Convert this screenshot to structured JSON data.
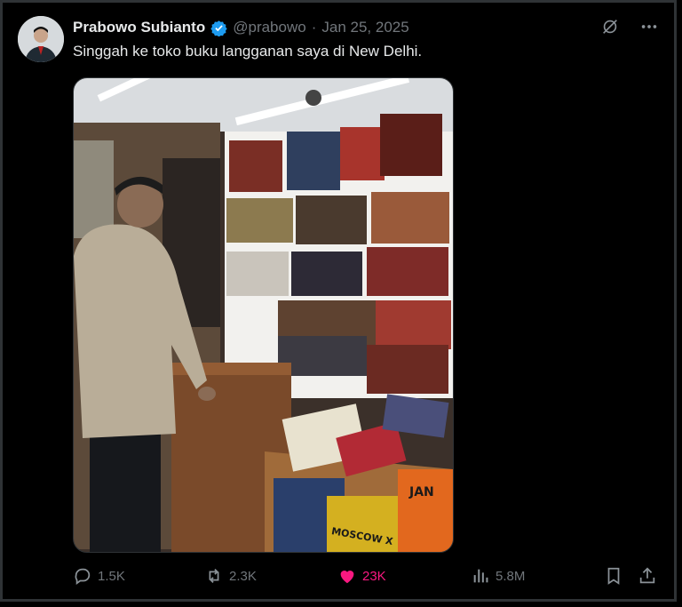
{
  "post": {
    "author_name": "Prabowo Subianto",
    "handle": "@prabowo",
    "separator": "·",
    "date": "Jan 25, 2025",
    "text": "Singgah ke toko buku langganan saya di New Delhi.",
    "verified_color": "#1d9bf0"
  },
  "actions": {
    "replies": "1.5K",
    "reposts": "2.3K",
    "likes": "23K",
    "views": "5.8M",
    "like_color": "#f91880"
  },
  "media": {
    "book_signs": [
      "MOSCOW X",
      "JAN"
    ]
  }
}
